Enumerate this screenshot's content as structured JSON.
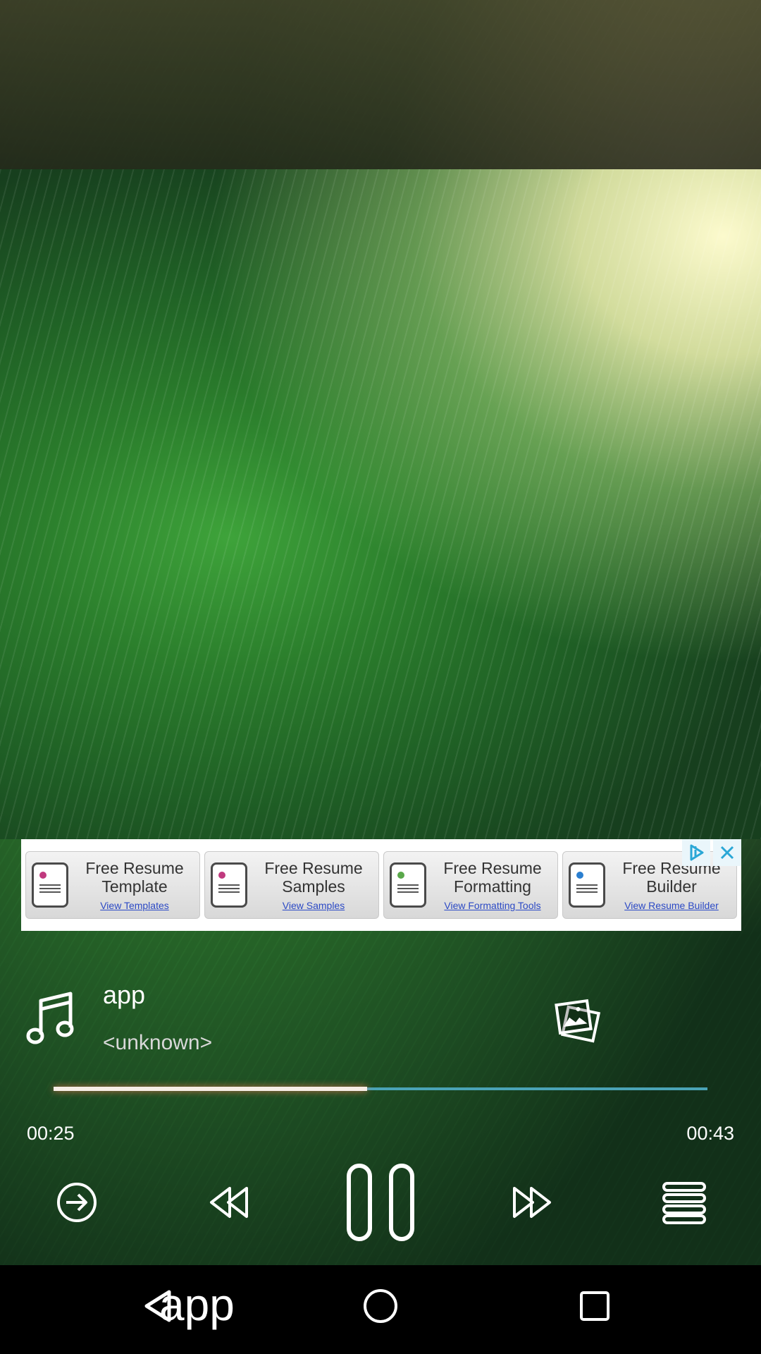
{
  "ad": {
    "cards": [
      {
        "title_line1": "Free Resume",
        "title_line2": "Template",
        "link": "View Templates",
        "icon": "resume-doc-icon",
        "dot_color": "#c0397e"
      },
      {
        "title_line1": "Free Resume",
        "title_line2": "Samples",
        "link": "View Samples",
        "icon": "resume-doc-icon",
        "dot_color": "#c0397e"
      },
      {
        "title_line1": "Free Resume",
        "title_line2": "Formatting",
        "link": "View Formatting Tools",
        "icon": "resume-doc-icon",
        "dot_color": "#5aa84a"
      },
      {
        "title_line1": "Free Resume",
        "title_line2": "Builder",
        "link": "View Resume Builder",
        "icon": "resume-doc-icon",
        "dot_color": "#2b7fd0"
      }
    ]
  },
  "track": {
    "title": "app",
    "artist": "<unknown>"
  },
  "playback": {
    "current_time": "00:25",
    "duration": "00:43",
    "progress_fraction": 0.48
  },
  "navbar": {
    "back_label": "app"
  },
  "colors": {
    "progress_track": "#4aa3b6",
    "progress_fill": "#f7eee6",
    "ad_link": "#2b49c5"
  }
}
